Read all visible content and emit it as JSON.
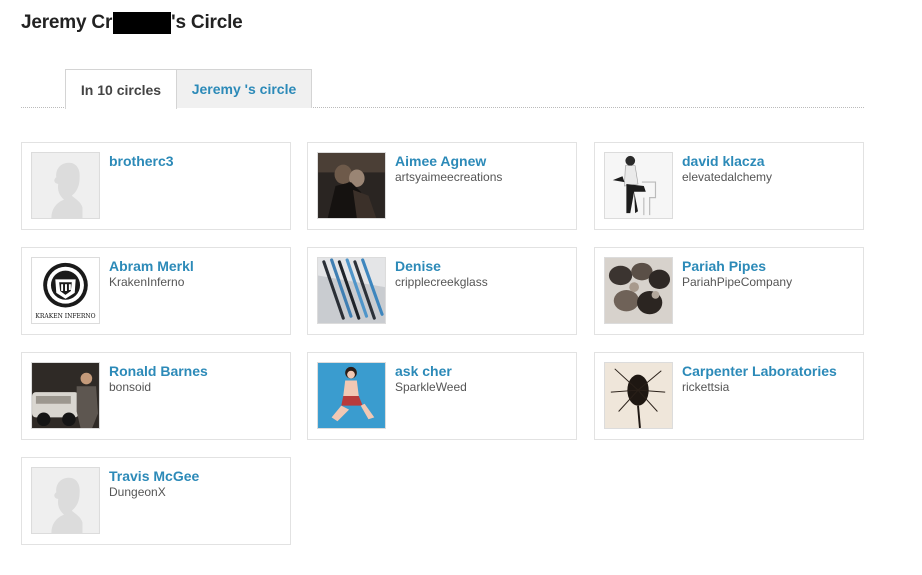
{
  "page": {
    "title_part1": "Jeremy Cr",
    "title_part2": "'s Circle"
  },
  "tabs": [
    {
      "label": "In 10 circles",
      "active": true
    },
    {
      "label": "Jeremy 's circle",
      "active": false
    }
  ],
  "people": [
    {
      "name": "brotherc3",
      "username": "",
      "avatar": "default-silhouette"
    },
    {
      "name": "Aimee Agnew",
      "username": "artsyaimeecreations",
      "avatar": "photo-two-people-dark"
    },
    {
      "name": "david klacza",
      "username": "elevatedalchemy",
      "avatar": "photo-person-on-chair"
    },
    {
      "name": "Abram Merkl",
      "username": "KrakenInferno",
      "avatar": "logo-kraken-inferno",
      "avatar_text": "KRAKEN INFERNO"
    },
    {
      "name": "Denise",
      "username": "cripplecreekglass",
      "avatar": "photo-glass-straws-blue"
    },
    {
      "name": "Pariah Pipes",
      "username": "PariahPipeCompany",
      "avatar": "photo-glass-pipes"
    },
    {
      "name": "Ronald Barnes",
      "username": "bonsoid",
      "avatar": "photo-man-with-car"
    },
    {
      "name": "ask cher",
      "username": "SparkleWeed",
      "avatar": "photo-pinup-blue"
    },
    {
      "name": "Carpenter Laboratories",
      "username": "rickettsia",
      "avatar": "photo-dried-teasel"
    },
    {
      "name": "Travis McGee",
      "username": "DungeonX",
      "avatar": "default-silhouette"
    }
  ],
  "colors": {
    "link": "#2c8ab8",
    "inactive_tab_bg": "#f0f0f0",
    "card_border": "#e2e2e2"
  }
}
